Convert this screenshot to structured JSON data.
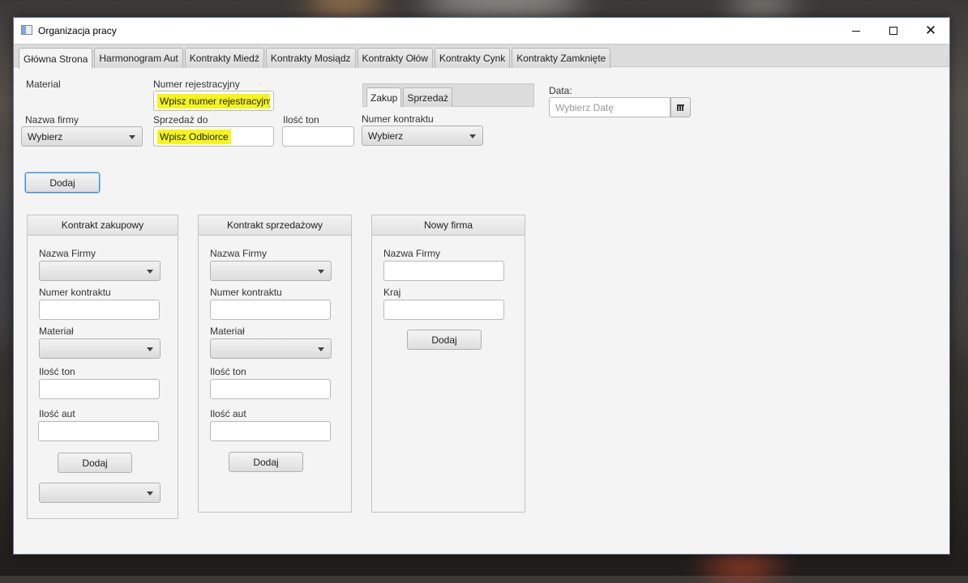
{
  "window": {
    "title": "Organizacja pracy"
  },
  "tabs": [
    "Główna Strona",
    "Harmonogram Aut",
    "Kontrakty Miedź",
    "Kontrakty Mosiądz",
    "Kontrakty Ołów",
    "Kontrakty Cynk",
    "Kontrakty Zamknięte"
  ],
  "main": {
    "material_label": "Material",
    "numer_rej_label": "Numer rejestracyjny",
    "numer_rej_placeholder": "Wpisz numer rejestracyjny",
    "nazwa_firmy_label": "Nazwa firmy",
    "nazwa_firmy_value": "Wybierz",
    "sprzedaz_do_label": "Sprzedaż do",
    "sprzedaz_do_placeholder": "Wpisz Odbiorce",
    "ilosc_ton_label": "Ilość ton",
    "subtabs": [
      "Zakup",
      "Sprzedaż"
    ],
    "numer_kontraktu_label": "Numer kontraktu",
    "numer_kontraktu_value": "Wybierz",
    "data_label": "Data:",
    "data_placeholder": "Wybierz Datę",
    "dodaj_label": "Dodaj"
  },
  "panel_zakup": {
    "title": "Kontrakt zakupowy",
    "nazwa_firmy": "Nazwa Firmy",
    "numer_kontraktu": "Numer kontraktu",
    "material": "Materiał",
    "ilosc_ton": "Ilość ton",
    "ilosc_aut": "Ilość aut",
    "dodaj": "Dodaj"
  },
  "panel_sprzedaz": {
    "title": "Kontrakt sprzedażowy",
    "nazwa_firmy": "Nazwa Firmy",
    "numer_kontraktu": "Numer kontraktu",
    "material": "Materiał",
    "ilosc_ton": "Ilość ton",
    "ilosc_aut": "Ilość aut",
    "dodaj": "Dodaj"
  },
  "panel_firma": {
    "title": "Nowy firma",
    "nazwa_firmy": "Nazwa Firmy",
    "kraj": "Kraj",
    "dodaj": "Dodaj"
  }
}
